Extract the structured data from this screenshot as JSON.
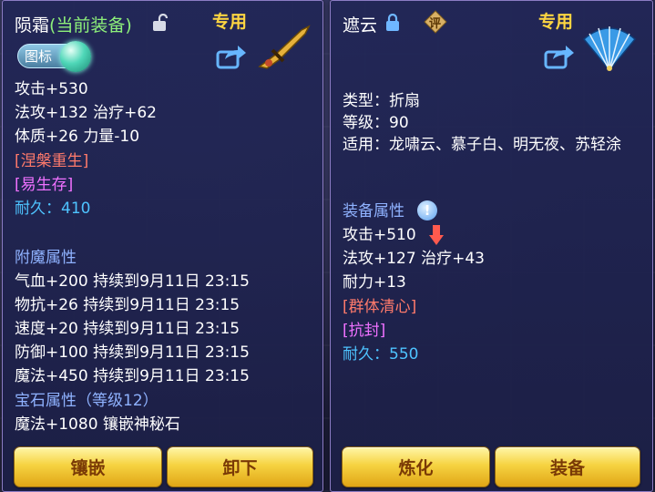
{
  "left": {
    "title": "陨霜",
    "equipped_tag": "(当前装备)",
    "exclusive": "专用",
    "badge_label": "图标",
    "lines": [
      "攻击+530",
      "法攻+132 治疗+62",
      "体质+26 力量-10"
    ],
    "skill1": "[涅槃重生]",
    "skill2": "[易生存]",
    "durability": "耐久：410",
    "enchant_title": "附魔属性",
    "enchants": [
      "气血+200 持续到9月11日 23:15",
      "物抗+26 持续到9月11日 23:15",
      "速度+20 持续到9月11日 23:15",
      "防御+100 持续到9月11日 23:15",
      "魔法+450 持续到9月11日 23:15"
    ],
    "gem_title": "宝石属性（等级12）",
    "gem_line": "魔法+1080 镶嵌神秘石",
    "btn_inlay": "镶嵌",
    "btn_unequip": "卸下"
  },
  "right": {
    "title": "遮云",
    "rate_icon": "评",
    "exclusive": "专用",
    "type_line": "类型：折扇",
    "level_line": "等级：90",
    "apply_line": "适用：龙啸云、慕子白、明无夜、苏轻涂",
    "attr_title": "装备属性",
    "attack": "攻击+510",
    "magic": "法攻+127 治疗+43",
    "endurance": "耐力+13",
    "skill1": "[群体清心]",
    "skill2": "[抗封]",
    "durability": "耐久：550",
    "btn_refine": "炼化",
    "btn_equip": "装备"
  },
  "colors": {
    "accent_gold": "#ffd641",
    "label_blue": "#8fb2ff",
    "skill_red": "#ff7a6b",
    "skill_purple": "#ef71ff",
    "durability_cyan": "#4ec3ff"
  }
}
